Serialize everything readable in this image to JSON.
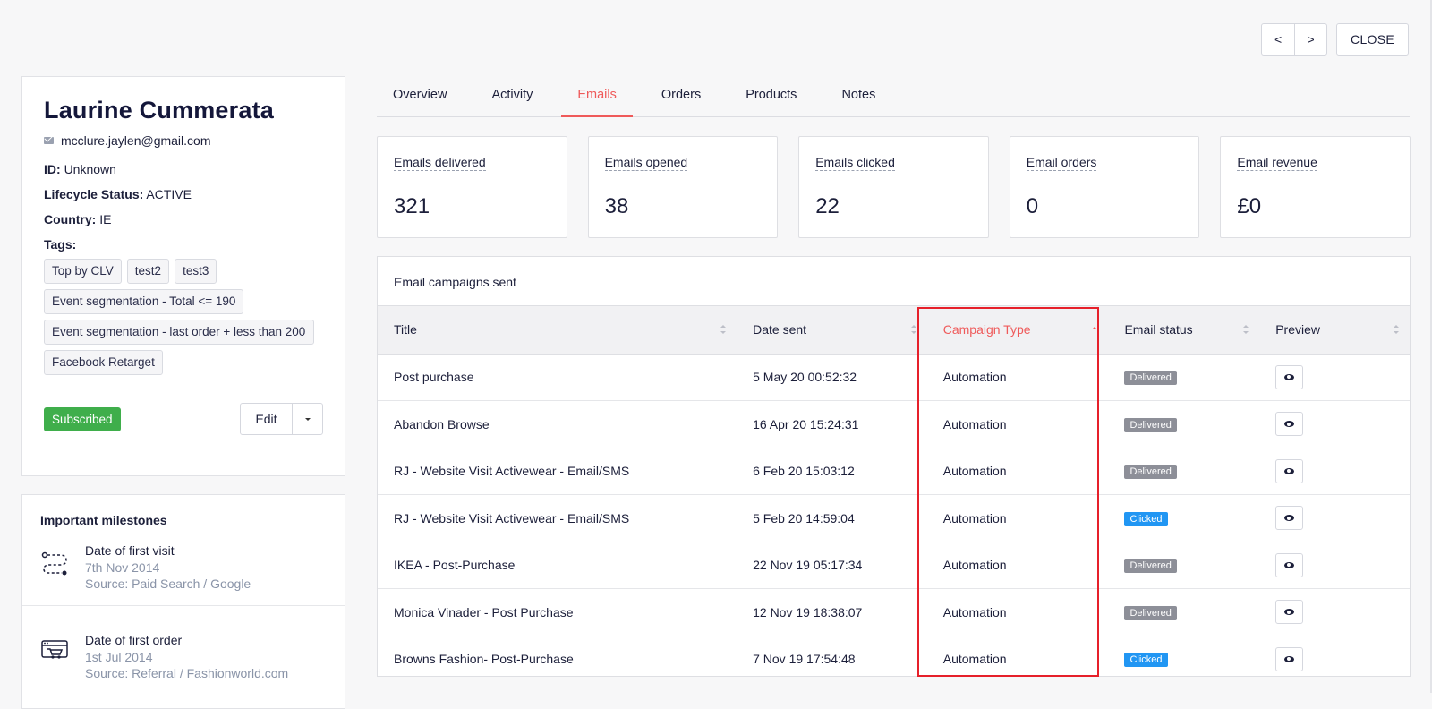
{
  "nav": {
    "prev": "<",
    "next": ">",
    "close": "CLOSE"
  },
  "profile": {
    "name": "Laurine Cummerata",
    "email": "mcclure.jaylen@gmail.com",
    "id_label": "ID:",
    "id_value": "Unknown",
    "lifecycle_label": "Lifecycle Status:",
    "lifecycle_value": "ACTIVE",
    "country_label": "Country:",
    "country_value": "IE",
    "tags_label": "Tags:",
    "tags": [
      "Top by CLV",
      "test2",
      "test3",
      "Event segmentation - Total <= 190",
      "Event segmentation - last order + less than 200",
      "Facebook Retarget"
    ],
    "subscribed": "Subscribed",
    "edit": "Edit"
  },
  "milestones": {
    "title": "Important milestones",
    "items": [
      {
        "title": "Date of first visit",
        "date": "7th Nov 2014",
        "source": "Source: Paid Search / Google",
        "icon": "route-icon"
      },
      {
        "title": "Date of first order",
        "date": "1st Jul 2014",
        "source": "Source: Referral / Fashionworld.com",
        "icon": "cart-icon"
      }
    ]
  },
  "tabs": [
    "Overview",
    "Activity",
    "Emails",
    "Orders",
    "Products",
    "Notes"
  ],
  "active_tab": "Emails",
  "stats": [
    {
      "label": "Emails delivered",
      "value": "321"
    },
    {
      "label": "Emails opened",
      "value": "38"
    },
    {
      "label": "Emails clicked",
      "value": "22"
    },
    {
      "label": "Email orders",
      "value": "0"
    },
    {
      "label": "Email revenue",
      "value": "£0"
    }
  ],
  "campaigns": {
    "title": "Email campaigns sent",
    "columns": [
      "Title",
      "Date sent",
      "Campaign Type",
      "Email status",
      "Preview"
    ],
    "sorted_column": "Campaign Type",
    "rows": [
      {
        "title": "Post purchase",
        "date": "5 May 20 00:52:32",
        "type": "Automation",
        "status": "Delivered"
      },
      {
        "title": "Abandon Browse",
        "date": "16 Apr 20 15:24:31",
        "type": "Automation",
        "status": "Delivered"
      },
      {
        "title": "RJ - Website Visit Activewear - Email/SMS",
        "date": "6 Feb 20 15:03:12",
        "type": "Automation",
        "status": "Delivered"
      },
      {
        "title": "RJ - Website Visit Activewear - Email/SMS",
        "date": "5 Feb 20 14:59:04",
        "type": "Automation",
        "status": "Clicked"
      },
      {
        "title": "IKEA - Post-Purchase",
        "date": "22 Nov 19 05:17:34",
        "type": "Automation",
        "status": "Delivered"
      },
      {
        "title": "Monica Vinader - Post Purchase",
        "date": "12 Nov 19 18:38:07",
        "type": "Automation",
        "status": "Delivered"
      },
      {
        "title": "Browns Fashion- Post-Purchase",
        "date": "7 Nov 19 17:54:48",
        "type": "Automation",
        "status": "Clicked"
      }
    ]
  },
  "colors": {
    "accent": "#ef5a5a",
    "subscribed": "#3fae4b",
    "clicked": "#2196f3",
    "delivered": "#8d8f98",
    "highlight": "#e6202a"
  }
}
